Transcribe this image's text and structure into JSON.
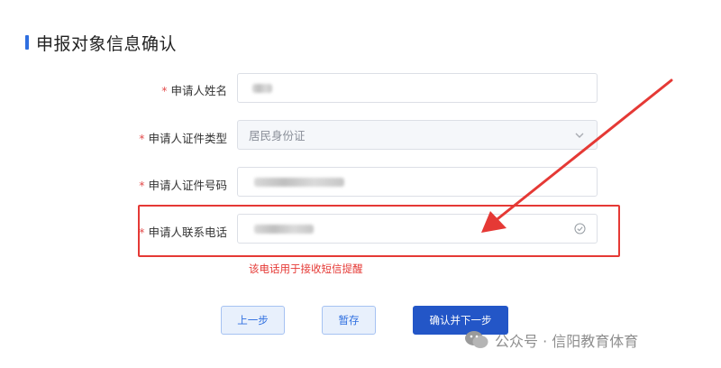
{
  "section": {
    "title": "申报对象信息确认"
  },
  "form": {
    "required_mark": "*",
    "fields": [
      {
        "label": "申请人姓名",
        "value": ""
      },
      {
        "label": "申请人证件类型",
        "value": "居民身份证"
      },
      {
        "label": "申请人证件号码",
        "value": ""
      },
      {
        "label": "申请人联系电话",
        "value": ""
      }
    ],
    "phone_hint": "该电话用于接收短信提醒"
  },
  "buttons": {
    "prev": "上一步",
    "save": "暂存",
    "confirm_next": "确认并下一步"
  },
  "icons": {
    "select_arrow": "chevron-down-icon",
    "valid": "check-circle-icon"
  },
  "colors": {
    "accent": "#2f6fe0",
    "primary_button": "#2356c7",
    "annotation_red": "#e53935"
  },
  "watermark": {
    "text": "公众号 · 信阳教育体育"
  }
}
